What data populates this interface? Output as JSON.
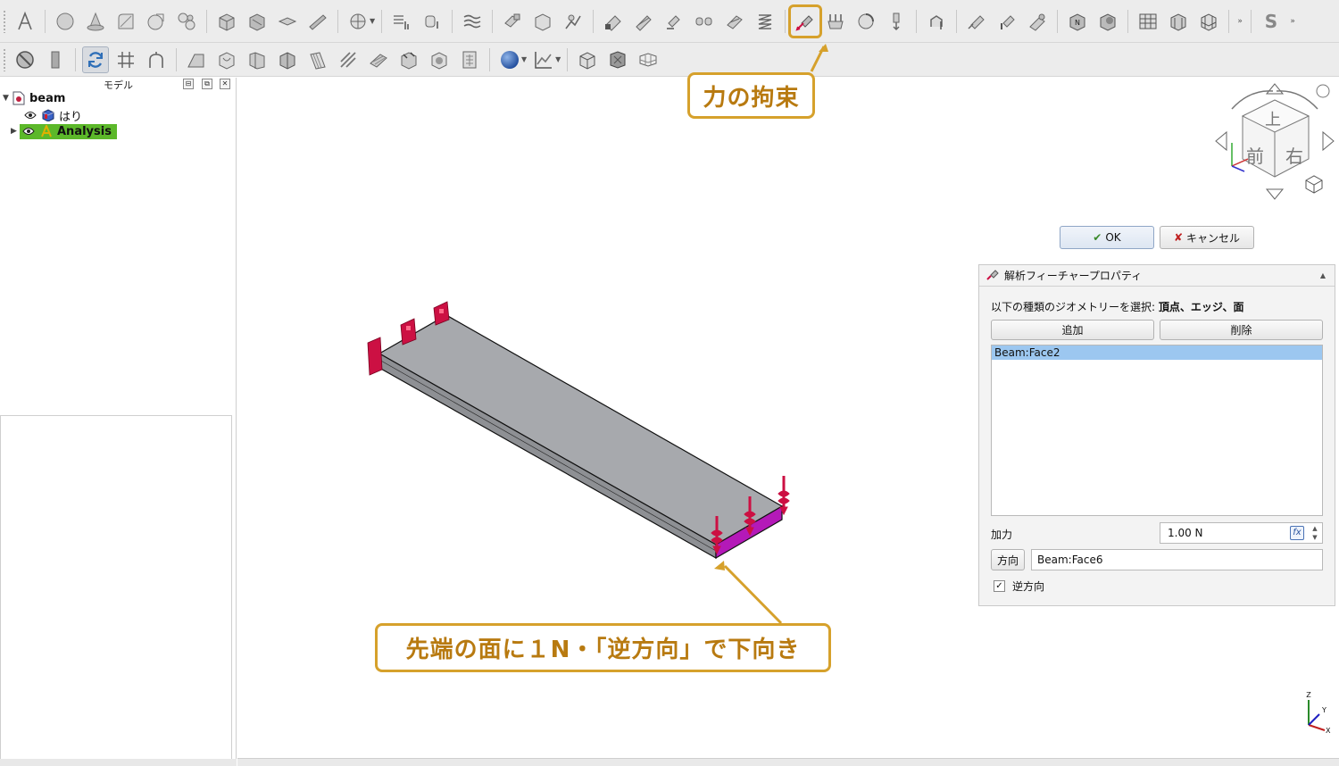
{
  "toolbar": {
    "row1_icons": [
      "text-icon",
      "sphere-icon",
      "cone-icon",
      "sketch-icon",
      "clipping-icon",
      "fillet-icon",
      "material-icon",
      "solid-icon",
      "shell-icon",
      "beam-icon",
      "mesh-net-icon",
      "node-icon",
      "mesh-region-icon",
      "mesh-group-icon",
      "mesh-layer-icon",
      "fixed-constraint-icon",
      "box-constraint-icon",
      "displacement-icon",
      "contact-icon",
      "tie-icon",
      "spring-icon",
      "sectionprint-icon",
      "transform-icon",
      "plane-rotation-icon",
      "force-constraint-icon",
      "pressure-icon",
      "centrif-icon",
      "self-weight-icon",
      "initial-temp-icon",
      "heatflux-icon",
      "temperature-icon",
      "body-heat-icon",
      "solver-ccx-icon",
      "solver-elmer-icon",
      "result-table-icon",
      "result-3d-icon",
      "result-cube-icon",
      "more-icon",
      "stylesheet-icon"
    ],
    "row2_icons": [
      "stop-icon",
      "panel-icon",
      "refresh-icon",
      "grid-icon",
      "branch-icon",
      "plot-icon",
      "post-warp-icon",
      "post-scalar-icon",
      "post-cut-icon",
      "post-clip-icon",
      "post-line-icon",
      "post-plane-icon",
      "post-glyph-icon",
      "post-contour-icon",
      "post-calculator-icon",
      "color-sphere-icon",
      "line-chart-icon",
      "box-view-icon",
      "box-front-icon",
      "box-wire-icon"
    ]
  },
  "model_panel": {
    "title": "モデル",
    "tree": [
      {
        "label": "beam",
        "icon": "document-icon"
      },
      {
        "label": "はり",
        "icon": "part-icon"
      },
      {
        "label": "Analysis",
        "icon": "analysis-icon"
      }
    ]
  },
  "nav_cube": {
    "top": "上",
    "front": "前",
    "right": "右"
  },
  "axis": {
    "z": "Z",
    "y": "Y",
    "x": "X"
  },
  "dialog": {
    "ok_label": "OK",
    "cancel_label": "キャンセル",
    "header": "解析フィーチャープロパティ",
    "geometry_prefix": "以下の種類のジオメトリーを選択:",
    "geometry_types": "頂点、エッジ、面",
    "add_label": "追加",
    "remove_label": "削除",
    "references": [
      "Beam:Face2"
    ],
    "force_label": "加力",
    "force_value": "1.00 N",
    "fx_label": "fx",
    "direction_label": "方向",
    "direction_value": "Beam:Face6",
    "reverse_label": "逆方向",
    "reverse_checked": true
  },
  "callouts": {
    "force": "力の拘束",
    "face": "先端の面に１N・「逆方向」で下向き"
  },
  "colors": {
    "accent": "#d6a12c",
    "callout_text": "#b87a10",
    "analysis_highlight": "#5cb82a",
    "constraint_red": "#cc1043",
    "face_magenta": "#b419b8",
    "beam_gray": "#a7a9ad",
    "selection_blue": "#9cc7f0"
  }
}
